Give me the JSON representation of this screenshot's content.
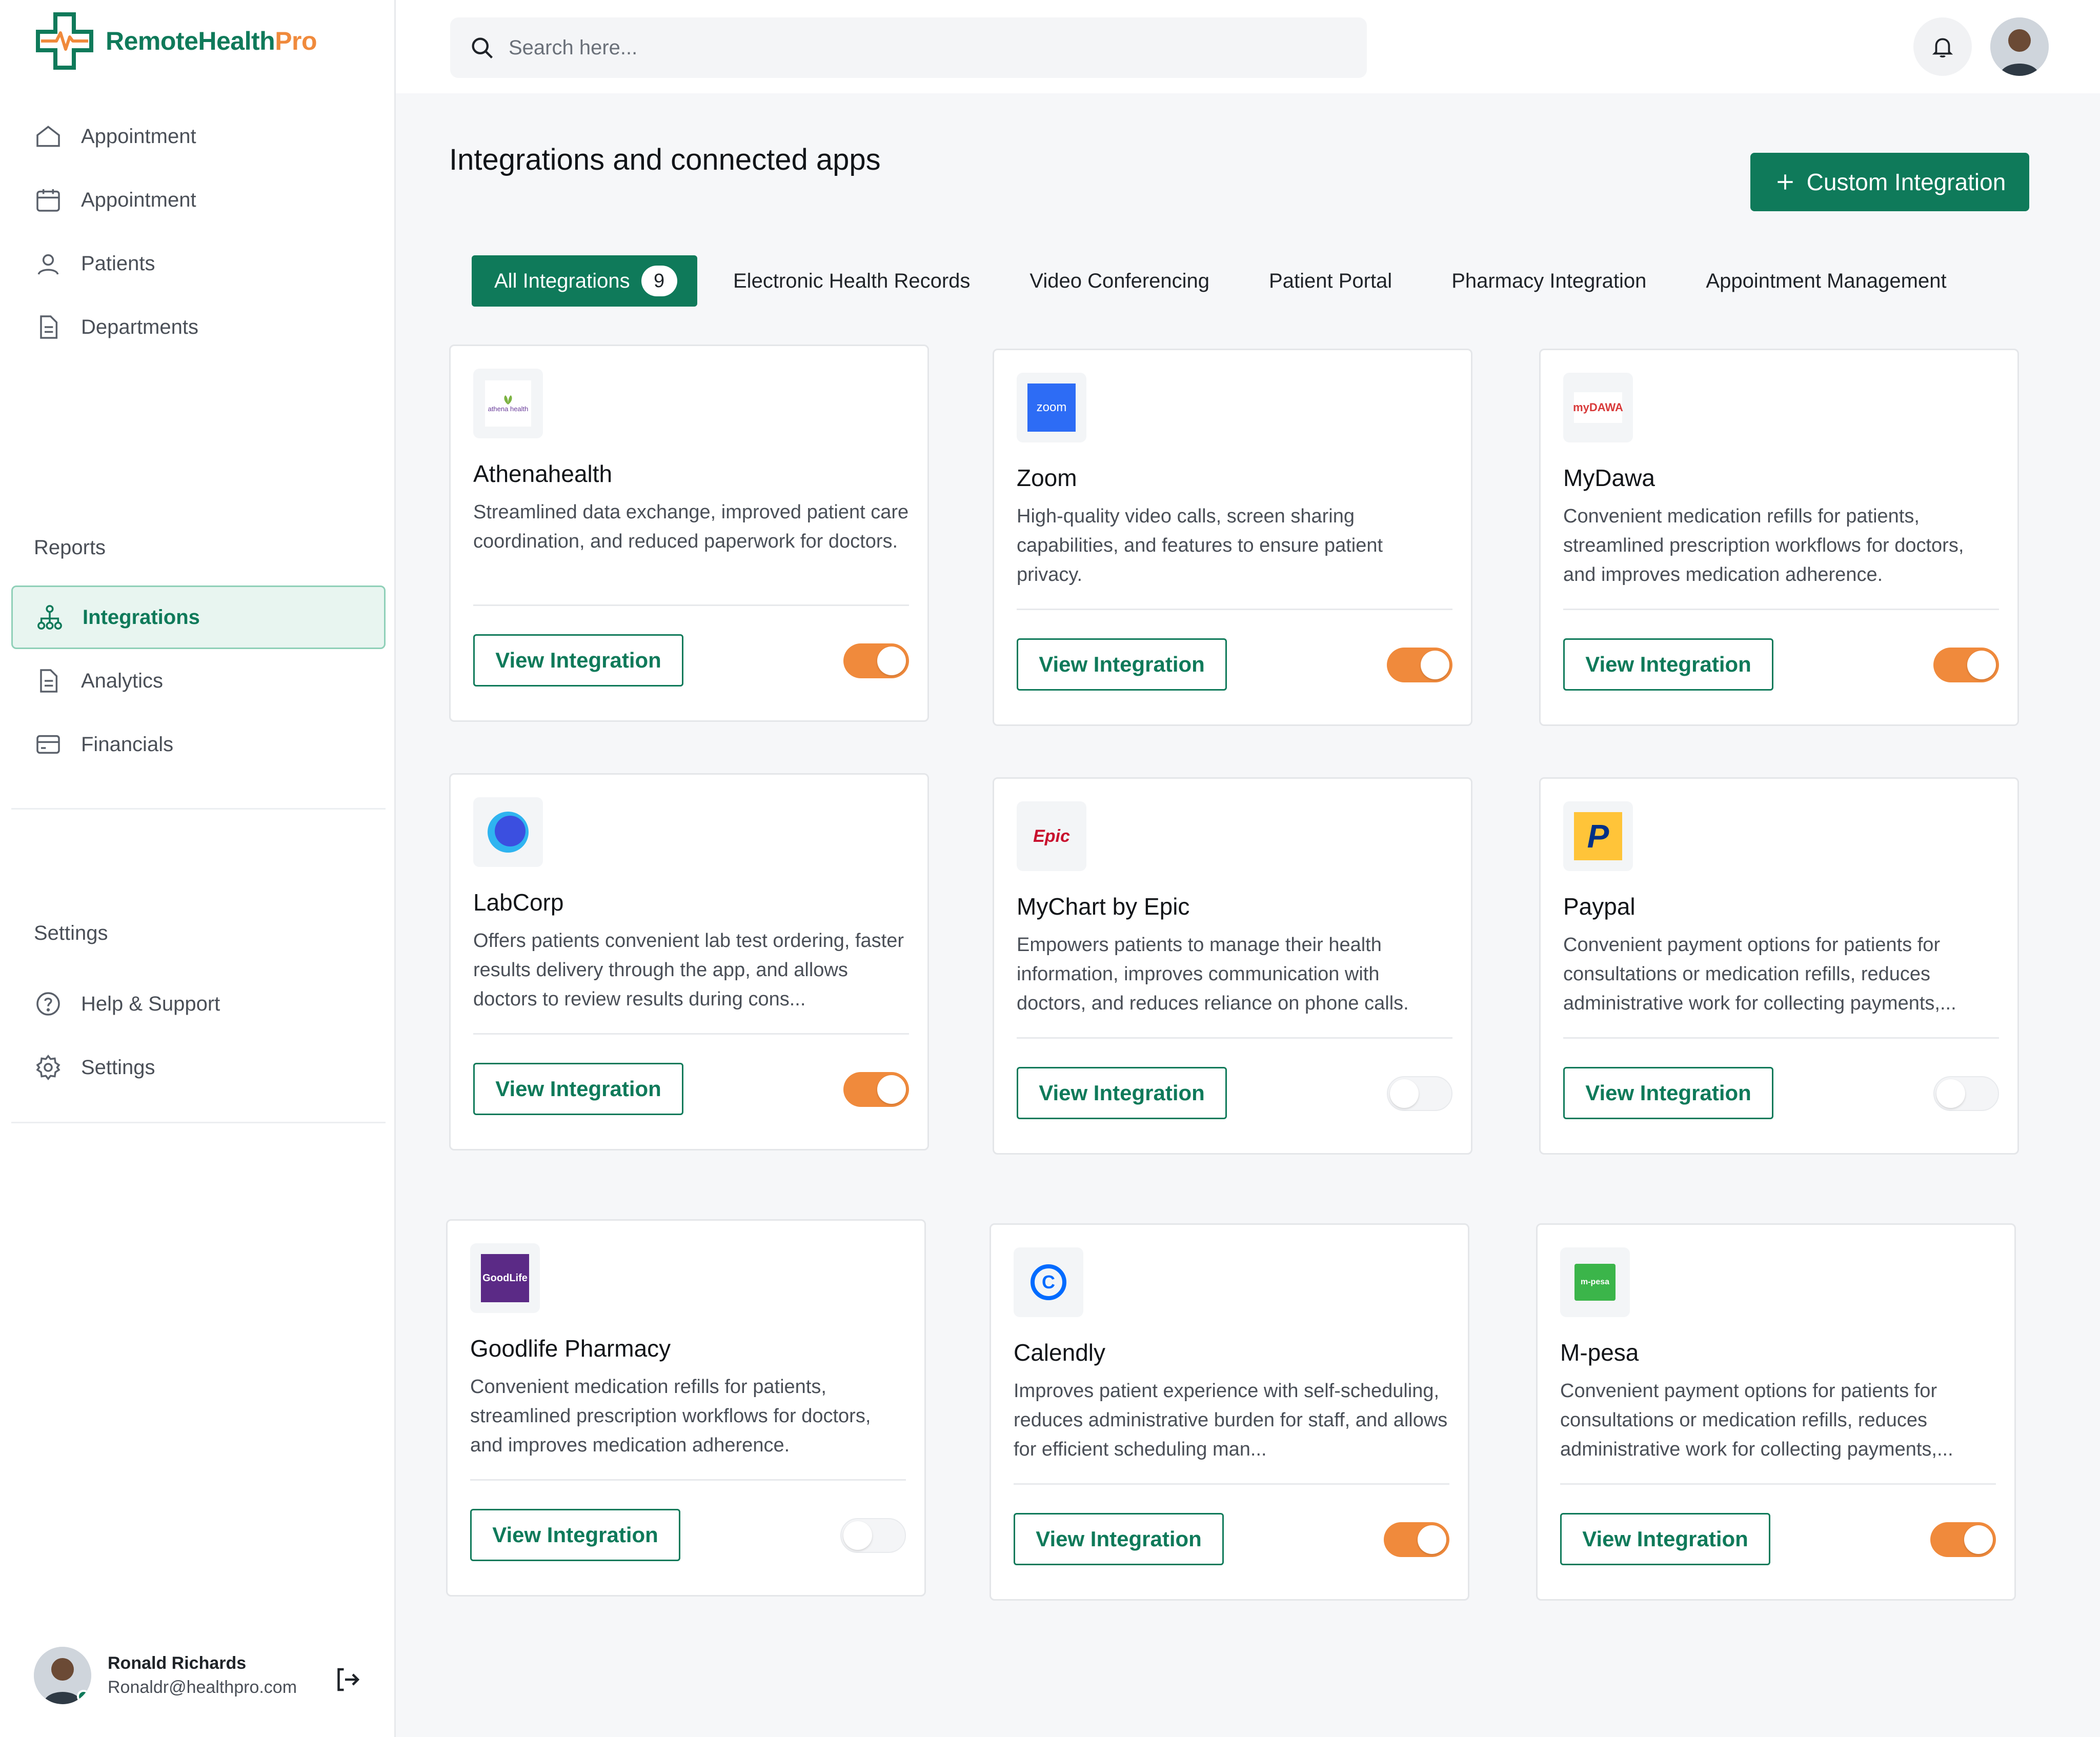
{
  "brand": {
    "name_part1": "RemoteHealth",
    "name_part2": "Pro",
    "primary": "#0f7a5a",
    "accent": "#f08a3c"
  },
  "sidebar": {
    "items": [
      {
        "label": "Appointment",
        "icon": "home-icon"
      },
      {
        "label": "Appointment",
        "icon": "calendar-icon"
      },
      {
        "label": "Patients",
        "icon": "patients-icon"
      },
      {
        "label": "Departments",
        "icon": "document-icon"
      }
    ],
    "reports_label": "Reports",
    "report_items": [
      {
        "label": "Integrations",
        "icon": "integrations-icon",
        "active": true
      },
      {
        "label": "Analytics",
        "icon": "document-icon"
      },
      {
        "label": "Financials",
        "icon": "card-icon"
      }
    ],
    "settings_label": "Settings",
    "settings_items": [
      {
        "label": "Help & Support",
        "icon": "help-icon"
      },
      {
        "label": "Settings",
        "icon": "gear-icon"
      }
    ],
    "user": {
      "name": "Ronald Richards",
      "email": "Ronaldr@healthpro.com"
    }
  },
  "search": {
    "placeholder": "Search here..."
  },
  "main": {
    "title": "Integrations and connected apps",
    "custom_button": "Custom Integration",
    "tabs": [
      {
        "label": "All Integrations",
        "count": "9",
        "active": true
      },
      {
        "label": "Electronic Health Records"
      },
      {
        "label": "Video Conferencing"
      },
      {
        "label": "Patient Portal"
      },
      {
        "label": "Pharmacy Integration"
      },
      {
        "label": "Appointment Management"
      }
    ],
    "view_button": "View Integration",
    "cards": [
      {
        "name": "Athenahealth",
        "desc": "Streamlined data exchange, improved patient care coordination, and reduced paperwork for doctors.",
        "enabled": true,
        "logo_text": "athena health"
      },
      {
        "name": "Zoom",
        "desc": "High-quality video calls, screen sharing capabilities, and features to ensure patient privacy.",
        "enabled": true,
        "logo_text": "zoom"
      },
      {
        "name": "MyDawa",
        "desc": "Convenient medication refills for patients, streamlined prescription workflows for doctors, and improves medication adherence.",
        "enabled": true,
        "logo_text": "myDAWA"
      },
      {
        "name": "LabCorp",
        "desc": "Offers patients convenient lab test ordering, faster results delivery through the app, and allows doctors to review results during cons...",
        "enabled": true,
        "logo_text": ""
      },
      {
        "name": "MyChart by Epic",
        "desc": "Empowers patients to manage their health information, improves communication with doctors, and reduces reliance on phone calls.",
        "enabled": false,
        "logo_text": "Epic"
      },
      {
        "name": "Paypal",
        "desc": "Convenient payment options for patients for consultations or medication refills, reduces administrative work for collecting payments,...",
        "enabled": false,
        "logo_text": "P"
      },
      {
        "name": "Goodlife Pharmacy",
        "desc": "Convenient medication refills for patients, streamlined prescription workflows for doctors, and improves medication adherence.",
        "enabled": false,
        "logo_text": "GoodLife"
      },
      {
        "name": "Calendly",
        "desc": "Improves patient experience with self-scheduling, reduces administrative burden for staff, and allows for efficient scheduling man...",
        "enabled": true,
        "logo_text": "C"
      },
      {
        "name": "M-pesa",
        "desc": "Convenient payment options for patients for consultations or medication refills, reduces administrative work for collecting payments,...",
        "enabled": true,
        "logo_text": "m-pesa"
      }
    ]
  }
}
